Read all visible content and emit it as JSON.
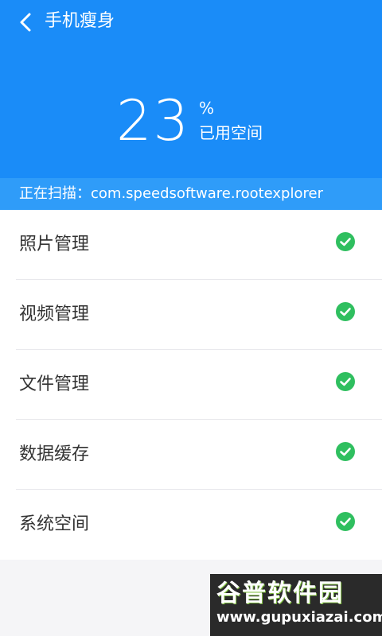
{
  "header": {
    "title": "手机瘦身",
    "usage_percent": "23",
    "percent_sign": "%",
    "used_label": "已用空间",
    "scan_text": "正在扫描：com.speedsoftware.rootexplorer"
  },
  "list": {
    "items": [
      {
        "label": "照片管理",
        "status": "done"
      },
      {
        "label": "视频管理",
        "status": "done"
      },
      {
        "label": "文件管理",
        "status": "done"
      },
      {
        "label": "数据缓存",
        "status": "done"
      },
      {
        "label": "系统空间",
        "status": "done"
      }
    ]
  },
  "watermark": {
    "title": "谷普软件园",
    "url": "www.gupuxiazai.com"
  },
  "colors": {
    "primary": "#1a8cf8",
    "scan_bar": "#2f9cf9",
    "check": "#2fbf5f"
  }
}
